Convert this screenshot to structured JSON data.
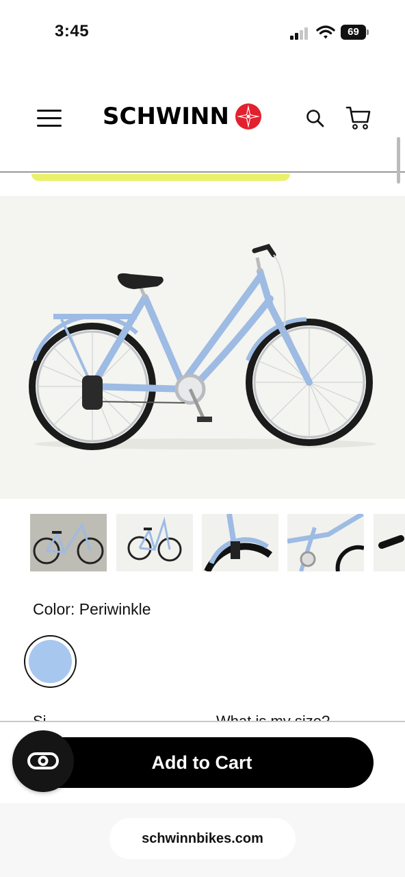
{
  "status_bar": {
    "time": "3:45",
    "battery_level": "69",
    "signal_bars_active": 2,
    "signal_bars_total": 4
  },
  "header": {
    "brand": "SCHWINN",
    "icons": [
      "menu-icon",
      "search-icon",
      "cart-icon"
    ],
    "promo_bar_color": "#eaf06a"
  },
  "product": {
    "hero_image": "periwinkle step-through cruiser bike",
    "thumbnail_count_visible": 5,
    "color_label": "Color: Periwinkle",
    "selected_color": "#a7c7ee",
    "size_label_partial": "Si",
    "size_guide_partial": "What is my size?"
  },
  "actions": {
    "add_to_cart_label": "Add to Cart"
  },
  "browser": {
    "url": "schwinnbikes.com"
  },
  "colors": {
    "brand_red": "#e4202e",
    "button_black": "#000000",
    "bike_frame": "#9dbbe3"
  }
}
